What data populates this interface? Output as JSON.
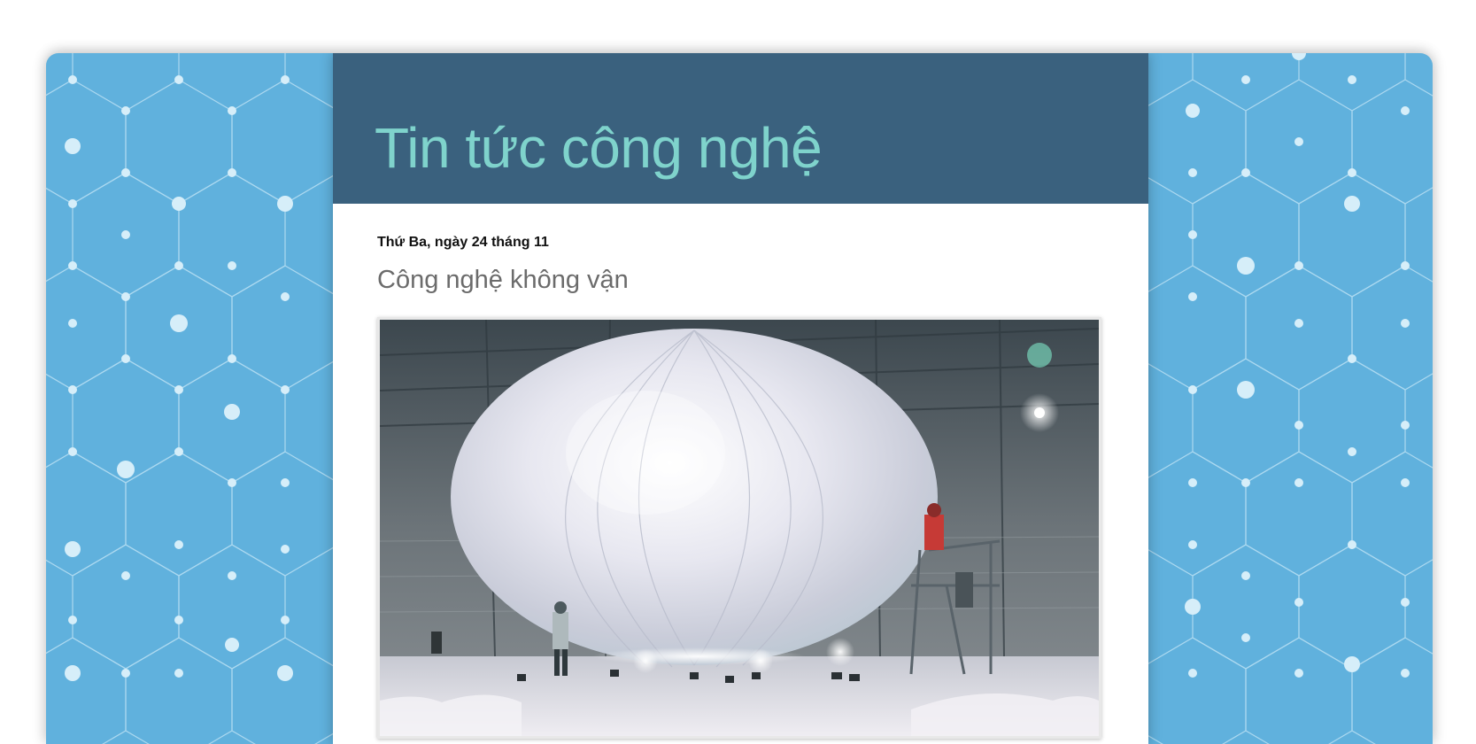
{
  "blog": {
    "title": "Tin tức công nghệ"
  },
  "post": {
    "date": "Thứ Ba, ngày 24 tháng 11",
    "title": "Công nghệ không vận",
    "image_subject": "balloon-photo"
  },
  "colors": {
    "background_pattern": "#60b1dd",
    "header": "#3a617e",
    "title": "#7fd3cc",
    "post_title": "#6b6b6b"
  }
}
